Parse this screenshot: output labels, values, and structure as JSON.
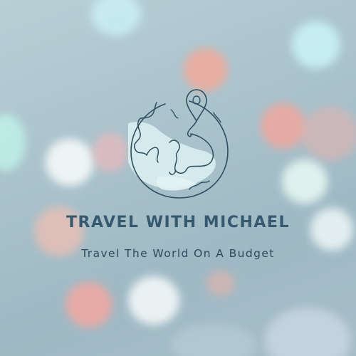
{
  "brand": {
    "title": "TRAVEL WITH MICHAEL",
    "tagline": "Travel The World On A Budget",
    "logo_icon": "globe-with-location-pin-icon"
  },
  "colors": {
    "title": "#36596f",
    "tagline": "#2f4a5c",
    "logo_stroke": "#2f4e60",
    "logo_fill": "#d9eef0"
  }
}
